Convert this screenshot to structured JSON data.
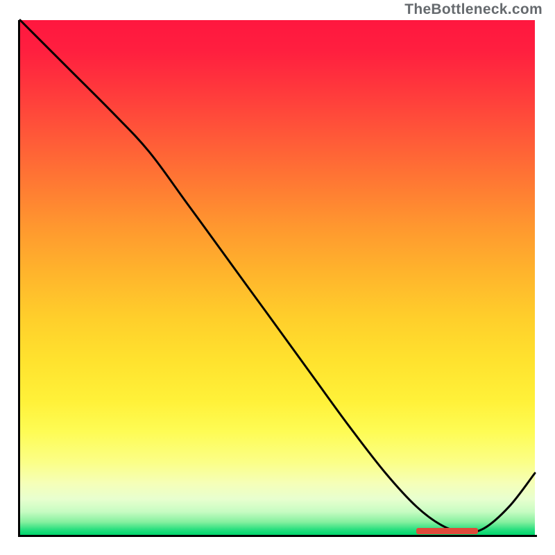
{
  "attribution": "TheBottleneck.com",
  "colors": {
    "gradient_top": "#ff173f",
    "gradient_bottom": "#00d66c",
    "curve": "#000000",
    "axis": "#000000",
    "marker": "#e04a3a"
  },
  "chart_data": {
    "type": "line",
    "title": "",
    "xlabel": "",
    "ylabel": "",
    "xlim": [
      0,
      100
    ],
    "ylim": [
      0,
      100
    ],
    "grid": false,
    "x": [
      0,
      3,
      10,
      18,
      25,
      32,
      40,
      48,
      56,
      64,
      71,
      77,
      82,
      86,
      90,
      95,
      100
    ],
    "values": [
      100,
      97,
      90,
      82,
      74.5,
      65,
      54,
      43,
      32,
      21,
      12,
      5.5,
      1.8,
      0.6,
      1.2,
      5.5,
      12
    ],
    "marker_range_x": [
      77,
      89
    ],
    "background_gradient": {
      "orientation": "vertical",
      "meaning": "bottleneck severity (red = high, green = low)"
    }
  }
}
